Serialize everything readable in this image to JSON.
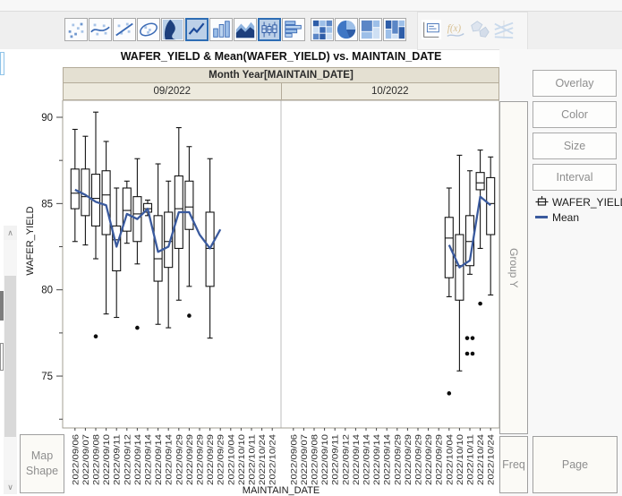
{
  "title": "WAFER_YIELD & Mean(WAFER_YIELD) vs. MAINTAIN_DATE",
  "toolbar": {
    "icons": [
      {
        "name": "scatter-icon",
        "selected": false,
        "disabled": false
      },
      {
        "name": "smoother-icon",
        "selected": false,
        "disabled": false
      },
      {
        "name": "line-of-fit-icon",
        "selected": false,
        "disabled": false
      },
      {
        "name": "ellipse-icon",
        "selected": false,
        "disabled": false
      },
      {
        "name": "contour-icon",
        "selected": false,
        "disabled": false
      },
      {
        "name": "line-chart-icon",
        "selected": true,
        "disabled": false
      },
      {
        "name": "bar-chart-icon",
        "selected": false,
        "disabled": false
      },
      {
        "name": "area-chart-icon",
        "selected": false,
        "disabled": false
      },
      {
        "name": "box-plot-icon",
        "selected": true,
        "disabled": false
      },
      {
        "name": "histogram-icon",
        "selected": false,
        "disabled": false
      },
      {
        "name": "heatmap-icon",
        "selected": false,
        "disabled": false
      },
      {
        "name": "pie-chart-icon",
        "selected": false,
        "disabled": false
      },
      {
        "name": "treemap-icon",
        "selected": false,
        "disabled": false
      },
      {
        "name": "mosaic-icon",
        "selected": false,
        "disabled": false
      },
      {
        "name": "caption-box-icon",
        "selected": false,
        "disabled": false
      },
      {
        "name": "formula-icon",
        "selected": false,
        "disabled": true
      },
      {
        "name": "map-shapes-icon",
        "selected": false,
        "disabled": true
      },
      {
        "name": "parallel-plot-icon",
        "selected": false,
        "disabled": true
      }
    ]
  },
  "drop_zones": {
    "overlay": "Overlay",
    "color": "Color",
    "size": "Size",
    "interval": "Interval",
    "group_y": "Group Y",
    "map_shape": "Map Shape",
    "freq": "Freq",
    "page": "Page"
  },
  "legend": {
    "items": [
      {
        "label": "WAFER_YIELD",
        "marker": "boxplot-glyph"
      },
      {
        "label": "Mean",
        "marker": "line",
        "color": "#3a5a9e"
      }
    ]
  },
  "chart_data": {
    "type": "boxplot",
    "title": "WAFER_YIELD & Mean(WAFER_YIELD) vs. MAINTAIN_DATE",
    "group_label": "Month Year[MAINTAIN_DATE]",
    "panels": [
      "09/2022",
      "10/2022"
    ],
    "xlabel": "MAINTAIN_DATE",
    "ylabel": "WAFER_YIELD",
    "ylim": [
      71.5,
      91
    ],
    "yticks": [
      90,
      85,
      80,
      75
    ],
    "yticks_minor": [
      87.5,
      82.5,
      77.5,
      72.5
    ],
    "grid": false,
    "legend_entries": [
      "WAFER_YIELD",
      "Mean"
    ],
    "categories": [
      "2022/09/06",
      "2022/09/07",
      "2022/09/08",
      "2022/09/10",
      "2022/09/11",
      "2022/09/12",
      "2022/09/14",
      "2022/09/14",
      "2022/09/14",
      "2022/09/14",
      "2022/09/29",
      "2022/09/29",
      "2022/09/29",
      "2022/09/29",
      "2022/09/29",
      "2022/10/04",
      "2022/10/10",
      "2022/10/11",
      "2022/10/24",
      "2022/10/24"
    ],
    "boxes": {
      "09/2022": [
        {
          "i": 0,
          "lo": 82.8,
          "q1": 84.7,
          "med": 85.6,
          "q3": 87.0,
          "hi": 89.3
        },
        {
          "i": 1,
          "lo": 82.6,
          "q1": 84.3,
          "med": 85.4,
          "q3": 87.0,
          "hi": 88.9
        },
        {
          "i": 2,
          "lo": 81.8,
          "q1": 83.7,
          "med": 85.3,
          "q3": 86.7,
          "hi": 90.3
        },
        {
          "i": 3,
          "lo": 78.6,
          "q1": 83.2,
          "med": 85.5,
          "q3": 86.9,
          "hi": 88.6
        },
        {
          "i": 4,
          "lo": 78.4,
          "q1": 81.1,
          "med": 82.9,
          "q3": 83.7,
          "hi": 85.9
        },
        {
          "i": 5,
          "lo": 82.7,
          "q1": 83.4,
          "med": 84.6,
          "q3": 85.9,
          "hi": 86.3
        },
        {
          "i": 6,
          "lo": 81.5,
          "q1": 82.8,
          "med": 84.4,
          "q3": 85.4,
          "hi": 87.6
        },
        {
          "i": 7,
          "lo": 84.3,
          "q1": 84.5,
          "med": 84.7,
          "q3": 85.0,
          "hi": 85.2
        },
        {
          "i": 8,
          "lo": 78.0,
          "q1": 80.5,
          "med": 81.8,
          "q3": 84.3,
          "hi": 87.3
        },
        {
          "i": 9,
          "lo": 77.8,
          "q1": 81.3,
          "med": 82.8,
          "q3": 84.5,
          "hi": 86.3
        },
        {
          "i": 10,
          "lo": 79.4,
          "q1": 82.4,
          "med": 84.7,
          "q3": 86.6,
          "hi": 89.4
        },
        {
          "i": 11,
          "lo": 80.2,
          "q1": 83.5,
          "med": 84.8,
          "q3": 86.3,
          "hi": 88.3
        },
        {
          "i": 13,
          "lo": 77.2,
          "q1": 80.2,
          "med": 82.4,
          "q3": 84.5,
          "hi": 87.6
        }
      ],
      "10/2022": [
        {
          "i": 15,
          "lo": 79.6,
          "q1": 80.7,
          "med": 83.0,
          "q3": 84.2,
          "hi": 85.9
        },
        {
          "i": 16,
          "lo": 75.3,
          "q1": 79.4,
          "med": 81.4,
          "q3": 83.2,
          "hi": 87.8
        },
        {
          "i": 17,
          "lo": 80.9,
          "q1": 81.4,
          "med": 82.8,
          "q3": 84.3,
          "hi": 86.9
        },
        {
          "i": 18,
          "lo": 82.4,
          "q1": 85.8,
          "med": 86.2,
          "q3": 86.8,
          "hi": 88.1
        },
        {
          "i": 19,
          "lo": 79.7,
          "q1": 83.2,
          "med": 85.0,
          "q3": 86.5,
          "hi": 87.7
        }
      ]
    },
    "outliers": {
      "09/2022": [
        {
          "i": 2,
          "v": 77.3
        },
        {
          "i": 6,
          "v": 77.8
        },
        {
          "i": 11,
          "v": 78.5
        }
      ],
      "10/2022": [
        {
          "i": 15,
          "v": 74.0
        },
        {
          "i": 17,
          "v": 77.2,
          "dx": -3
        },
        {
          "i": 17,
          "v": 77.2,
          "dx": 3
        },
        {
          "i": 17,
          "v": 76.3,
          "dx": -3
        },
        {
          "i": 17,
          "v": 76.3,
          "dx": 3
        },
        {
          "i": 18,
          "v": 79.2
        }
      ]
    },
    "mean_line": {
      "09/2022": [
        [
          0,
          85.8
        ],
        [
          1,
          85.5
        ],
        [
          2,
          85.1
        ],
        [
          3,
          84.9
        ],
        [
          4,
          82.5
        ],
        [
          5,
          84.4
        ],
        [
          6,
          84.1
        ],
        [
          7,
          84.7
        ],
        [
          8,
          82.2
        ],
        [
          9,
          82.5
        ],
        [
          10,
          84.5
        ],
        [
          11,
          84.5
        ],
        [
          12,
          83.2
        ],
        [
          13,
          82.4
        ],
        [
          14,
          83.5
        ]
      ],
      "10/2022": [
        [
          15,
          82.6
        ],
        [
          16,
          81.3
        ],
        [
          17,
          81.7
        ],
        [
          18,
          85.4
        ],
        [
          19,
          84.9
        ]
      ]
    },
    "colors": {
      "box_stroke": "#141414",
      "mean_line": "#3a5a9e",
      "outlier": "#0d0d0d",
      "panel_header_bg": "#e4e0d2",
      "panel_subheader_bg": "#edeade"
    }
  }
}
